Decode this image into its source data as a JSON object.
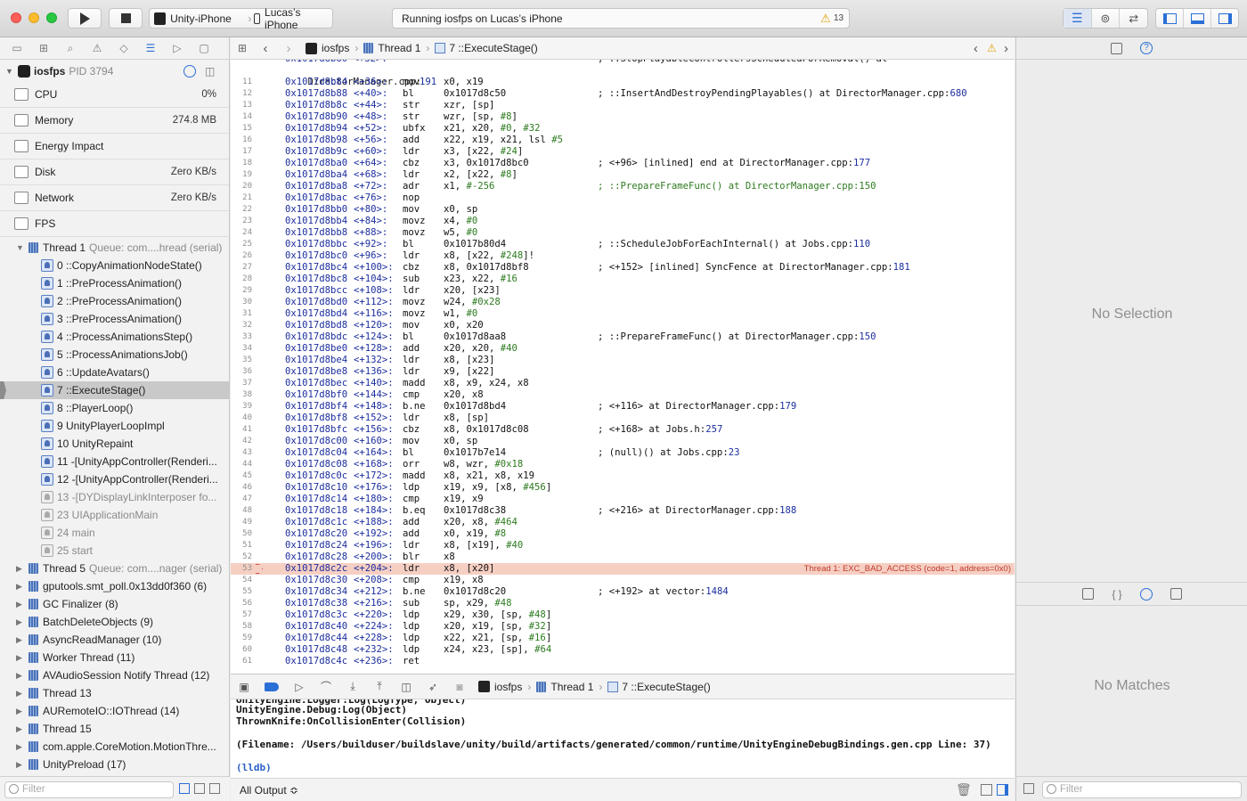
{
  "toolbar": {
    "scheme": "Unity-iPhone",
    "device": "Lucas’s iPhone",
    "status": "Running iosfps on Lucas’s iPhone",
    "warning_count": "13"
  },
  "process": {
    "name": "iosfps",
    "pid": "PID 3794"
  },
  "gauges": [
    {
      "name": "CPU",
      "value": "0%"
    },
    {
      "name": "Memory",
      "value": "274.8 MB"
    },
    {
      "name": "Energy Impact",
      "value": ""
    },
    {
      "name": "Disk",
      "value": "Zero KB/s"
    },
    {
      "name": "Network",
      "value": "Zero KB/s"
    },
    {
      "name": "FPS",
      "value": ""
    }
  ],
  "thread1": {
    "name": "Thread 1",
    "queue": "Queue: com....hread (serial)"
  },
  "frames": [
    "0 ::CopyAnimationNodeState()",
    "1 ::PreProcessAnimation()",
    "2 ::PreProcessAnimation()",
    "3 ::PreProcessAnimation()",
    "4 ::ProcessAnimationsStep()",
    "5 ::ProcessAnimationsJob()",
    "6 ::UpdateAvatars()",
    "7 ::ExecuteStage()",
    "8 ::PlayerLoop()",
    "9 UnityPlayerLoopImpl",
    "10 UnityRepaint",
    "11 -[UnityAppController(Renderi...",
    "12 -[UnityAppController(Renderi...",
    "13 -[DYDisplayLinkInterposer fo...",
    "23 UIApplicationMain",
    "24 main",
    "25 start"
  ],
  "other_threads": [
    {
      "name": "Thread 5",
      "queue": "Queue: com....nager (serial)"
    },
    {
      "name": "gputools.smt_poll.0x13dd0f360 (6)",
      "queue": ""
    },
    {
      "name": "GC Finalizer (8)",
      "queue": ""
    },
    {
      "name": "BatchDeleteObjects (9)",
      "queue": ""
    },
    {
      "name": "AsyncReadManager (10)",
      "queue": ""
    },
    {
      "name": "Worker Thread (11)",
      "queue": ""
    },
    {
      "name": "AVAudioSession Notify Thread (12)",
      "queue": ""
    },
    {
      "name": "Thread 13",
      "queue": ""
    },
    {
      "name": "AURemoteIO::IOThread (14)",
      "queue": ""
    },
    {
      "name": "Thread 15",
      "queue": ""
    },
    {
      "name": "com.apple.CoreMotion.MotionThre...",
      "queue": ""
    },
    {
      "name": "UnityPreload (17)",
      "queue": ""
    }
  ],
  "nav_filter_placeholder": "Filter",
  "jumpbar": {
    "project": "iosfps",
    "thread": "Thread 1",
    "frame": "7 ::ExecuteStage()"
  },
  "top_partial_line": "    DirectorManager.cpp:",
  "top_partial_ref": "191",
  "code": [
    {
      "n": "11",
      "a": "0x1017d8b84",
      "o": "<+36>:",
      "op": "mov",
      "args": "x0, x19",
      "c": ""
    },
    {
      "n": "12",
      "a": "0x1017d8b88",
      "o": "<+40>:",
      "op": "bl",
      "args": "0x1017d8c50",
      "c": "; ::InsertAndDestroyPendingPlayables() at DirectorManager.cpp:",
      "cr": "680"
    },
    {
      "n": "13",
      "a": "0x1017d8b8c",
      "o": "<+44>:",
      "op": "str",
      "args": "xzr, [sp]",
      "c": ""
    },
    {
      "n": "14",
      "a": "0x1017d8b90",
      "o": "<+48>:",
      "op": "str",
      "args": "wzr, [sp, #8]",
      "c": ""
    },
    {
      "n": "15",
      "a": "0x1017d8b94",
      "o": "<+52>:",
      "op": "ubfx",
      "args": "x21, x20, #0, #32",
      "c": ""
    },
    {
      "n": "16",
      "a": "0x1017d8b98",
      "o": "<+56>:",
      "op": "add",
      "args": "x22, x19, x21, lsl #5",
      "c": ""
    },
    {
      "n": "17",
      "a": "0x1017d8b9c",
      "o": "<+60>:",
      "op": "ldr",
      "args": "x3, [x22, #24]",
      "c": ""
    },
    {
      "n": "18",
      "a": "0x1017d8ba0",
      "o": "<+64>:",
      "op": "cbz",
      "args": "x3, 0x1017d8bc0",
      "c": "; <+96> [inlined] end at DirectorManager.cpp:",
      "cr": "177"
    },
    {
      "n": "19",
      "a": "0x1017d8ba4",
      "o": "<+68>:",
      "op": "ldr",
      "args": "x2, [x22, #8]",
      "c": ""
    },
    {
      "n": "20",
      "a": "0x1017d8ba8",
      "o": "<+72>:",
      "op": "adr",
      "args": "x1, #-256",
      "c": "; ::PrepareFrameFunc() at DirectorManager.cpp:150",
      "green": true
    },
    {
      "n": "21",
      "a": "0x1017d8bac",
      "o": "<+76>:",
      "op": "nop",
      "args": "",
      "c": ""
    },
    {
      "n": "22",
      "a": "0x1017d8bb0",
      "o": "<+80>:",
      "op": "mov",
      "args": "x0, sp",
      "c": ""
    },
    {
      "n": "23",
      "a": "0x1017d8bb4",
      "o": "<+84>:",
      "op": "movz",
      "args": "x4, #0",
      "c": ""
    },
    {
      "n": "24",
      "a": "0x1017d8bb8",
      "o": "<+88>:",
      "op": "movz",
      "args": "w5, #0",
      "c": ""
    },
    {
      "n": "25",
      "a": "0x1017d8bbc",
      "o": "<+92>:",
      "op": "bl",
      "args": "0x1017b80d4",
      "c": "; ::ScheduleJobForEachInternal() at Jobs.cpp:",
      "cr": "110"
    },
    {
      "n": "26",
      "a": "0x1017d8bc0",
      "o": "<+96>:",
      "op": "ldr",
      "args": "x8, [x22, #248]!",
      "c": ""
    },
    {
      "n": "27",
      "a": "0x1017d8bc4",
      "o": "<+100>:",
      "op": "cbz",
      "args": "x8, 0x1017d8bf8",
      "c": "; <+152> [inlined] SyncFence at DirectorManager.cpp:",
      "cr": "181"
    },
    {
      "n": "28",
      "a": "0x1017d8bc8",
      "o": "<+104>:",
      "op": "sub",
      "args": "x23, x22, #16",
      "c": ""
    },
    {
      "n": "29",
      "a": "0x1017d8bcc",
      "o": "<+108>:",
      "op": "ldr",
      "args": "x20, [x23]",
      "c": ""
    },
    {
      "n": "30",
      "a": "0x1017d8bd0",
      "o": "<+112>:",
      "op": "movz",
      "args": "w24, #0x28",
      "c": ""
    },
    {
      "n": "31",
      "a": "0x1017d8bd4",
      "o": "<+116>:",
      "op": "movz",
      "args": "w1, #0",
      "c": ""
    },
    {
      "n": "32",
      "a": "0x1017d8bd8",
      "o": "<+120>:",
      "op": "mov",
      "args": "x0, x20",
      "c": ""
    },
    {
      "n": "33",
      "a": "0x1017d8bdc",
      "o": "<+124>:",
      "op": "bl",
      "args": "0x1017d8aa8",
      "c": "; ::PrepareFrameFunc() at DirectorManager.cpp:",
      "cr": "150"
    },
    {
      "n": "34",
      "a": "0x1017d8be0",
      "o": "<+128>:",
      "op": "add",
      "args": "x20, x20, #40",
      "c": ""
    },
    {
      "n": "35",
      "a": "0x1017d8be4",
      "o": "<+132>:",
      "op": "ldr",
      "args": "x8, [x23]",
      "c": ""
    },
    {
      "n": "36",
      "a": "0x1017d8be8",
      "o": "<+136>:",
      "op": "ldr",
      "args": "x9, [x22]",
      "c": ""
    },
    {
      "n": "37",
      "a": "0x1017d8bec",
      "o": "<+140>:",
      "op": "madd",
      "args": "x8, x9, x24, x8",
      "c": ""
    },
    {
      "n": "38",
      "a": "0x1017d8bf0",
      "o": "<+144>:",
      "op": "cmp",
      "args": "x20, x8",
      "c": ""
    },
    {
      "n": "39",
      "a": "0x1017d8bf4",
      "o": "<+148>:",
      "op": "b.ne",
      "args": "0x1017d8bd4",
      "c": "; <+116> at DirectorManager.cpp:",
      "cr": "179"
    },
    {
      "n": "40",
      "a": "0x1017d8bf8",
      "o": "<+152>:",
      "op": "ldr",
      "args": "x8, [sp]",
      "c": ""
    },
    {
      "n": "41",
      "a": "0x1017d8bfc",
      "o": "<+156>:",
      "op": "cbz",
      "args": "x8, 0x1017d8c08",
      "c": "; <+168> at Jobs.h:",
      "cr": "257"
    },
    {
      "n": "42",
      "a": "0x1017d8c00",
      "o": "<+160>:",
      "op": "mov",
      "args": "x0, sp",
      "c": ""
    },
    {
      "n": "43",
      "a": "0x1017d8c04",
      "o": "<+164>:",
      "op": "bl",
      "args": "0x1017b7e14",
      "c": "; (null)() at Jobs.cpp:",
      "cr": "23"
    },
    {
      "n": "44",
      "a": "0x1017d8c08",
      "o": "<+168>:",
      "op": "orr",
      "args": "w8, wzr, #0x18",
      "c": ""
    },
    {
      "n": "45",
      "a": "0x1017d8c0c",
      "o": "<+172>:",
      "op": "madd",
      "args": "x8, x21, x8, x19",
      "c": ""
    },
    {
      "n": "46",
      "a": "0x1017d8c10",
      "o": "<+176>:",
      "op": "ldp",
      "args": "x19, x9, [x8, #456]",
      "c": ""
    },
    {
      "n": "47",
      "a": "0x1017d8c14",
      "o": "<+180>:",
      "op": "cmp",
      "args": "x19, x9",
      "c": ""
    },
    {
      "n": "48",
      "a": "0x1017d8c18",
      "o": "<+184>:",
      "op": "b.eq",
      "args": "0x1017d8c38",
      "c": "; <+216> at DirectorManager.cpp:",
      "cr": "188"
    },
    {
      "n": "49",
      "a": "0x1017d8c1c",
      "o": "<+188>:",
      "op": "add",
      "args": "x20, x8, #464",
      "c": ""
    },
    {
      "n": "50",
      "a": "0x1017d8c20",
      "o": "<+192>:",
      "op": "add",
      "args": "x0, x19, #8",
      "c": ""
    },
    {
      "n": "51",
      "a": "0x1017d8c24",
      "o": "<+196>:",
      "op": "ldr",
      "args": "x8, [x19], #40",
      "c": ""
    },
    {
      "n": "52",
      "a": "0x1017d8c28",
      "o": "<+200>:",
      "op": "blr",
      "args": "x8",
      "c": ""
    },
    {
      "n": "53",
      "a": "0x1017d8c2c",
      "o": "<+204>:",
      "op": "ldr",
      "args": "x8, [x20]",
      "c": "",
      "crash": "Thread 1: EXC_BAD_ACCESS (code=1, address=0x0)"
    },
    {
      "n": "54",
      "a": "0x1017d8c30",
      "o": "<+208>:",
      "op": "cmp",
      "args": "x19, x8",
      "c": ""
    },
    {
      "n": "55",
      "a": "0x1017d8c34",
      "o": "<+212>:",
      "op": "b.ne",
      "args": "0x1017d8c20",
      "c": "; <+192> at vector:",
      "cr": "1484"
    },
    {
      "n": "56",
      "a": "0x1017d8c38",
      "o": "<+216>:",
      "op": "sub",
      "args": "sp, x29, #48",
      "c": ""
    },
    {
      "n": "57",
      "a": "0x1017d8c3c",
      "o": "<+220>:",
      "op": "ldp",
      "args": "x29, x30, [sp, #48]",
      "c": ""
    },
    {
      "n": "58",
      "a": "0x1017d8c40",
      "o": "<+224>:",
      "op": "ldp",
      "args": "x20, x19, [sp, #32]",
      "c": ""
    },
    {
      "n": "59",
      "a": "0x1017d8c44",
      "o": "<+228>:",
      "op": "ldp",
      "args": "x22, x21, [sp, #16]",
      "c": ""
    },
    {
      "n": "60",
      "a": "0x1017d8c48",
      "o": "<+232>:",
      "op": "ldp",
      "args": "x24, x23, [sp], #64",
      "c": ""
    },
    {
      "n": "61",
      "a": "0x1017d8c4c",
      "o": "<+236>:",
      "op": "ret",
      "args": "",
      "c": ""
    }
  ],
  "debugbar": {
    "project": "iosfps",
    "thread": "Thread 1",
    "frame": "7 ::ExecuteStage()"
  },
  "console": {
    "line1": "UnityEngine.Debug:Log(Object)",
    "line2": "ThrownKnife:OnCollisionEnter(Collision)",
    "line3": "(Filename: /Users/builduser/buildslave/unity/build/artifacts/generated/common/runtime/UnityEngineDebugBindings.gen.cpp Line: 37)",
    "prompt": "(lldb)",
    "output_selector": "All Output ≎"
  },
  "inspector": {
    "top_placeholder": "No Selection",
    "bottom_placeholder": "No Matches",
    "filter_placeholder": "Filter"
  }
}
